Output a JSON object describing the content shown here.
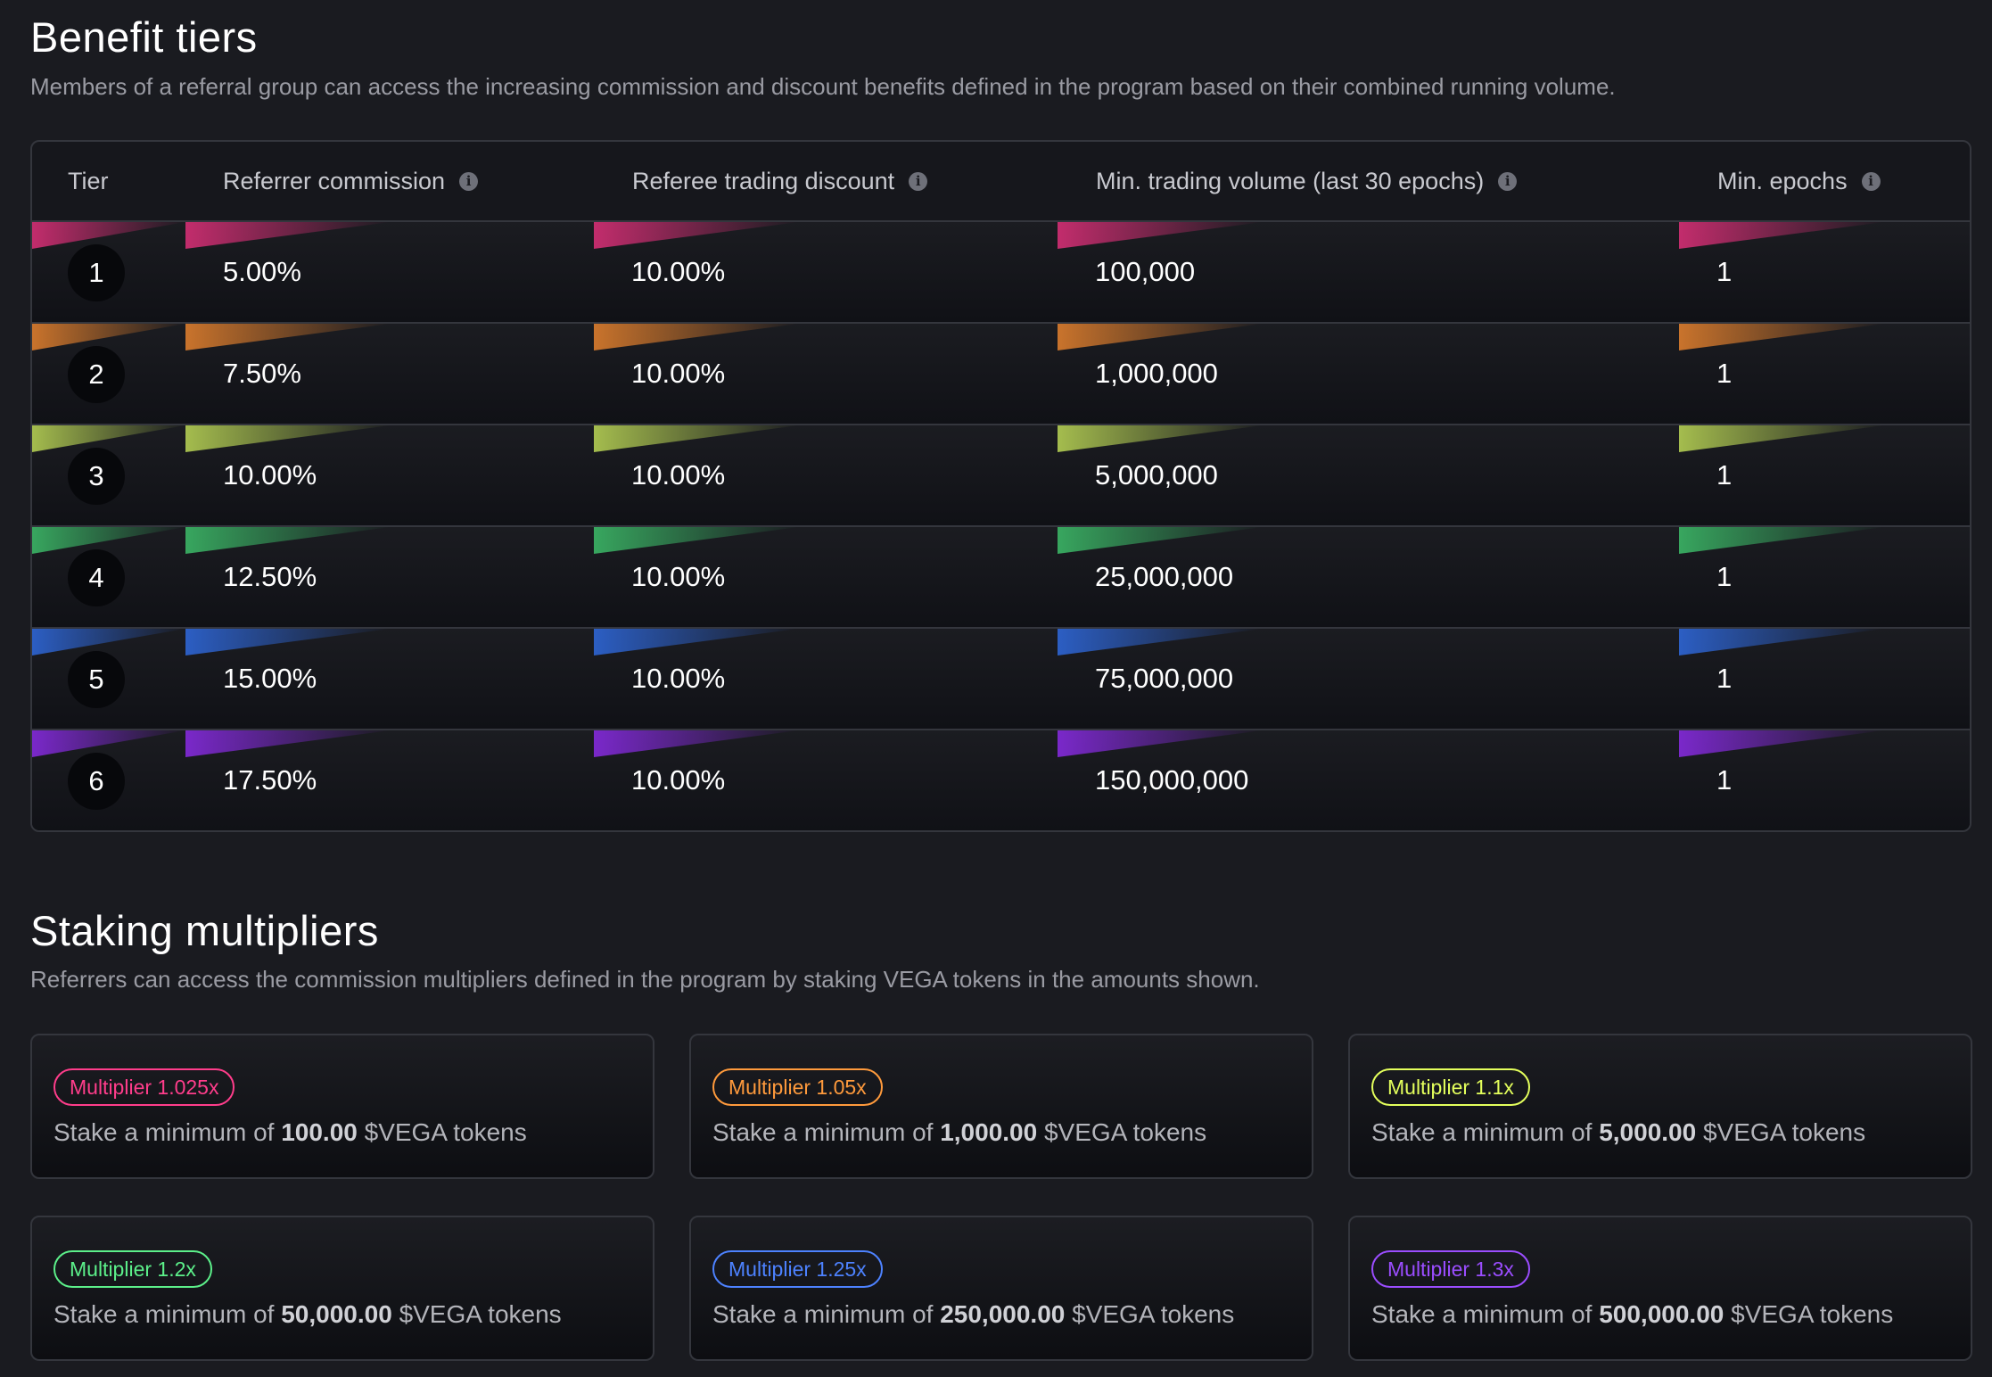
{
  "benefit_tiers": {
    "title": "Benefit tiers",
    "description": "Members of a referral group can access the increasing commission and discount benefits defined in the program based on their combined running volume.",
    "columns": [
      "Tier",
      "Referrer commission",
      "Referee trading discount",
      "Min. trading volume (last 30 epochs)",
      "Min. epochs"
    ],
    "info_icon": "i",
    "rows": [
      {
        "tier": "1",
        "commission": "5.00%",
        "discount": "10.00%",
        "volume": "100,000",
        "epochs": "1",
        "color": "#e0307a"
      },
      {
        "tier": "2",
        "commission": "7.50%",
        "discount": "10.00%",
        "volume": "1,000,000",
        "epochs": "1",
        "color": "#e8832e"
      },
      {
        "tier": "3",
        "commission": "10.00%",
        "discount": "10.00%",
        "volume": "5,000,000",
        "epochs": "1",
        "color": "#bdd956"
      },
      {
        "tier": "4",
        "commission": "12.50%",
        "discount": "10.00%",
        "volume": "25,000,000",
        "epochs": "1",
        "color": "#3dbf6a"
      },
      {
        "tier": "5",
        "commission": "15.00%",
        "discount": "10.00%",
        "volume": "75,000,000",
        "epochs": "1",
        "color": "#2f6ae0"
      },
      {
        "tier": "6",
        "commission": "17.50%",
        "discount": "10.00%",
        "volume": "150,000,000",
        "epochs": "1",
        "color": "#8b2be8"
      }
    ]
  },
  "staking_multipliers": {
    "title": "Staking multipliers",
    "description": "Referrers can access the commission multipliers defined in the program by staking VEGA tokens in the amounts shown.",
    "stake_prefix": "Stake a minimum of",
    "stake_suffix": "$VEGA tokens",
    "cards": [
      {
        "label": "Multiplier 1.025x",
        "amount": "100.00",
        "color": "#ff3d8b"
      },
      {
        "label": "Multiplier 1.05x",
        "amount": "1,000.00",
        "color": "#ff9a3c"
      },
      {
        "label": "Multiplier 1.1x",
        "amount": "5,000.00",
        "color": "#e4ff5c"
      },
      {
        "label": "Multiplier 1.2x",
        "amount": "50,000.00",
        "color": "#5cf08a"
      },
      {
        "label": "Multiplier 1.25x",
        "amount": "250,000.00",
        "color": "#4d82ff"
      },
      {
        "label": "Multiplier 1.3x",
        "amount": "500,000.00",
        "color": "#9b4dff"
      }
    ]
  }
}
